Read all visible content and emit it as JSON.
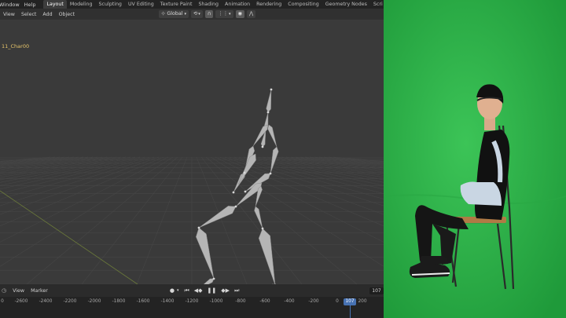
{
  "app": {
    "menu": [
      "Window",
      "Help"
    ],
    "workspace_tabs": [
      {
        "label": "Layout",
        "active": true
      },
      {
        "label": "Modeling",
        "active": false
      },
      {
        "label": "Sculpting",
        "active": false
      },
      {
        "label": "UV Editing",
        "active": false
      },
      {
        "label": "Texture Paint",
        "active": false
      },
      {
        "label": "Shading",
        "active": false
      },
      {
        "label": "Animation",
        "active": false
      },
      {
        "label": "Rendering",
        "active": false
      },
      {
        "label": "Compositing",
        "active": false
      },
      {
        "label": "Geometry Nodes",
        "active": false
      },
      {
        "label": "Scri",
        "active": false
      }
    ]
  },
  "viewport_header": {
    "items": [
      "View",
      "Select",
      "Add",
      "Object"
    ],
    "orientation": "Global"
  },
  "viewport": {
    "object_name": "11_Char00"
  },
  "timeline": {
    "items": [
      "View",
      "Marker"
    ],
    "current_frame": "107",
    "frame_badge": "107",
    "ruler_ticks": [
      "0",
      "-2600",
      "-2400",
      "-2200",
      "-2000",
      "-1800",
      "-1600",
      "-1400",
      "-1200",
      "-1000",
      "-800",
      "-600",
      "-400",
      "-200",
      "0",
      "200"
    ]
  },
  "colors": {
    "accent": "#4772b3",
    "green_screen": "#2fb34a",
    "bone": "#b8b8b8"
  }
}
